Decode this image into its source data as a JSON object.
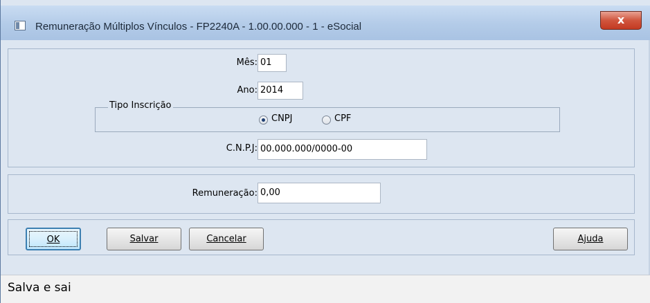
{
  "window": {
    "title": "Remuneração Múltiplos Vínculos - FP2240A - 1.00.00.000 - 1 - eSocial",
    "close_label": "x"
  },
  "form": {
    "mes_label": "Mês:",
    "mes_value": "01",
    "ano_label": "Ano:",
    "ano_value": "2014",
    "tipo_inscricao": {
      "legend": "Tipo Inscrição",
      "options": [
        "CNPJ",
        "CPF"
      ],
      "selected": "CNPJ"
    },
    "cnpj_label": "C.N.P.J:",
    "cnpj_value": "00.000.000/0000-00",
    "remuneracao_label": "Remuneração:",
    "remuneracao_value": "0,00"
  },
  "buttons": {
    "ok": "OK",
    "salvar": "Salvar",
    "cancelar": "Cancelar",
    "ajuda": "Ajuda"
  },
  "status": {
    "text": "Salva e sai"
  }
}
